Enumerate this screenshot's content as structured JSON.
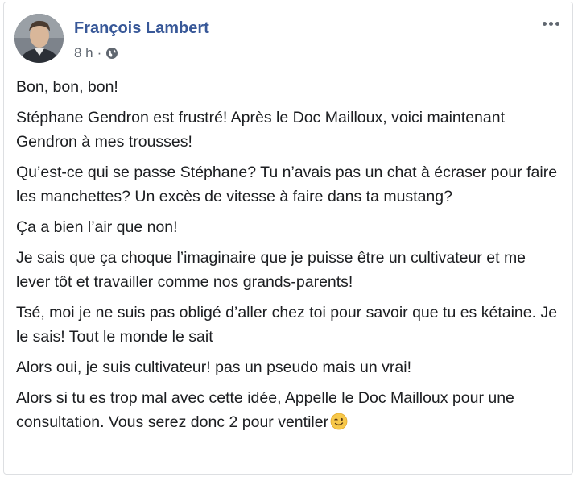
{
  "post": {
    "author": "François Lambert",
    "time": "8 h",
    "separator": "·",
    "privacy_icon": "globe-icon",
    "more_icon": "more-options-icon",
    "paragraphs": [
      "Bon, bon, bon!",
      "Stéphane Gendron est frustré! Après le Doc Mailloux, voici maintenant Gendron à mes trousses!",
      "Qu’est-ce qui se passe Stéphane? Tu n’avais pas un chat à écraser pour faire les manchettes? Un excès de vitesse à faire dans ta mustang?",
      "Ça a bien l’air que non!",
      "Je sais que ça choque l’imaginaire que je puisse être un cultivateur et me lever tôt et travailler comme nos grands-parents!",
      "Tsé, moi je ne suis pas obligé d’aller chez toi pour savoir que tu es kétaine. Je le sais! Tout le monde le sait",
      "Alors oui, je suis cultivateur! pas un pseudo mais un vrai!",
      "Alors si tu es trop mal avec cette idée, Appelle le Doc Mailloux pour une consultation. Vous serez donc 2 pour ventiler"
    ],
    "trailing_emoji": "wink-emoji",
    "colors": {
      "author": "#385898",
      "meta": "#606770",
      "text": "#1c1e21",
      "border": "#dddfe2"
    }
  }
}
